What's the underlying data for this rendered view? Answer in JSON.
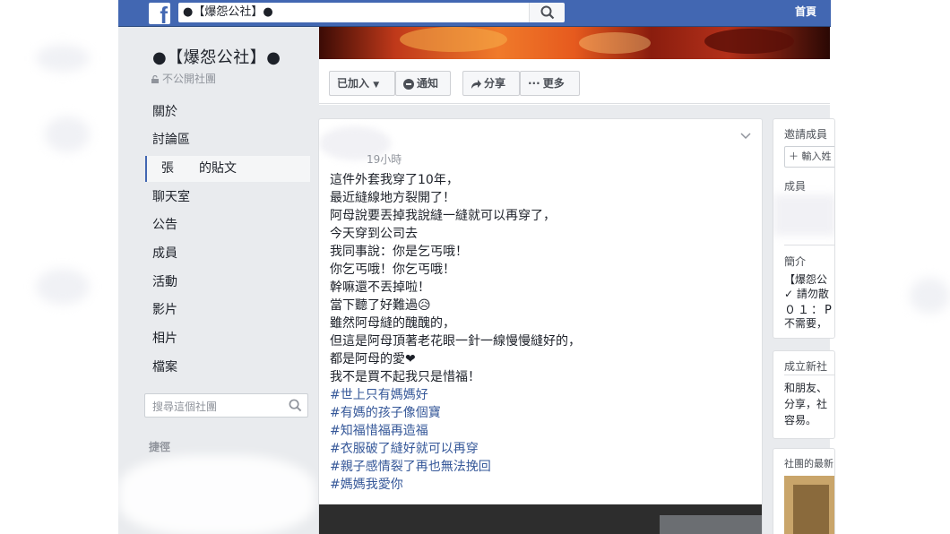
{
  "topbar": {
    "search_value": "●【爆怨公社】●",
    "home_label": "首頁"
  },
  "group": {
    "name": "●【爆怨公社】●",
    "privacy": "不公開社團"
  },
  "nav": {
    "items": [
      {
        "label": "關於"
      },
      {
        "label": "討論區"
      },
      {
        "label": "張　　的貼文"
      },
      {
        "label": "聊天室"
      },
      {
        "label": "公告"
      },
      {
        "label": "成員"
      },
      {
        "label": "活動"
      },
      {
        "label": "影片"
      },
      {
        "label": "相片"
      },
      {
        "label": "檔案"
      }
    ],
    "search_placeholder": "搜尋這個社團",
    "shortcuts_label": "捷徑"
  },
  "actions": {
    "joined": "已加入",
    "notify": "通知",
    "share": "分享",
    "more": "更多"
  },
  "post": {
    "time": "19小時",
    "lines": [
      "這件外套我穿了10年，",
      "最近縫線地方裂開了！",
      "阿母說要丟掉我說縫一縫就可以再穿了，",
      "今天穿到公司去",
      "我同事說：你是乞丐哦！",
      "你乞丐哦！你乞丐哦！",
      "幹嘛還不丟掉啦！",
      "當下聽了好難過😥",
      "雖然阿母縫的醜醜的，",
      "但這是阿母頂著老花眼一針一線慢慢縫好的，",
      "都是阿母的愛❤",
      "我不是買不起我只是惜福！"
    ],
    "hashtags": [
      "#世上只有媽媽好",
      "#有媽的孩子像個寶",
      "#知福惜福再造福",
      "#衣服破了縫好就可以再穿",
      "#親子感情裂了再也無法挽回",
      "#媽媽我愛你"
    ]
  },
  "right": {
    "invite_label": "邀請成員",
    "invite_input": "＋ 輸入姓",
    "members_label": "成員",
    "intro_label": "簡介",
    "intro_lines": [
      "【爆怨公",
      "✓ 請勿散",
      "０１：P",
      "不需要，"
    ],
    "new_group_label": "成立新社",
    "new_group_lines": [
      "和朋友、",
      "分享，社",
      "容易。"
    ],
    "recent_label": "社團的最新"
  },
  "colors": {
    "fb_blue": "#4267b2",
    "link": "#365899",
    "page_bg": "#e9ebee"
  }
}
